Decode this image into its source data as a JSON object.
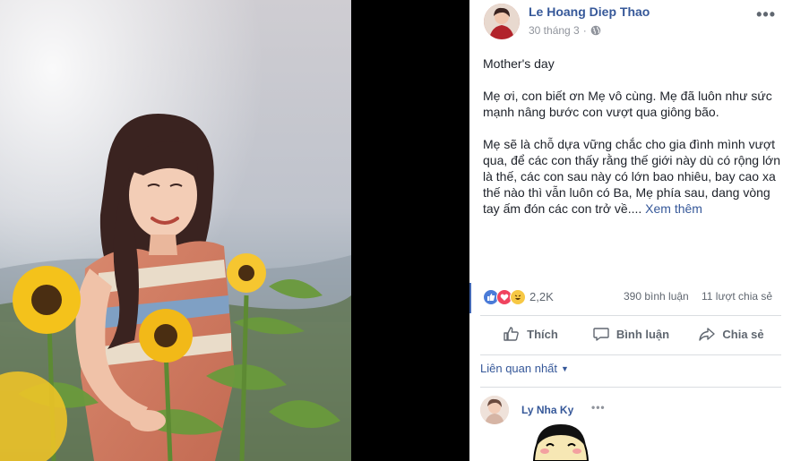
{
  "post": {
    "author": "Le Hoang Diep Thao",
    "date": "30 tháng 3",
    "privacy_separator": "·",
    "privacy_icon": "globe-icon",
    "more_icon": "•••",
    "paragraphs": [
      "Mother's day",
      "Mẹ ơi, con biết ơn Mẹ vô cùng. Mẹ đã luôn như sức mạnh nâng bước con vượt qua giông bão.",
      "Mẹ sẽ là chỗ dựa vững chắc cho gia đình mình vượt qua, để các con thấy rằng thế giới này dù có rộng lớn là thế, các con sau này có lớn bao nhiêu, bay cao xa thế nào thì vẫn luôn có Ba, Mẹ phía sau, dang vòng tay ấm đón các con trở về...."
    ],
    "see_more": "Xem thêm"
  },
  "stats": {
    "reaction_icons": [
      "like-reaction-icon",
      "love-reaction-icon",
      "haha-reaction-icon"
    ],
    "reaction_count": "2,2K",
    "comments": "390 bình luận",
    "shares": "11 lượt chia sẻ"
  },
  "actions": {
    "like": "Thích",
    "comment": "Bình luận",
    "share": "Chia sẻ"
  },
  "comments_section": {
    "sort_label": "Liên quan nhất",
    "sort_caret": "▼",
    "first_comment": {
      "author": "Ly Nha Ky",
      "more": "•••"
    }
  },
  "colors": {
    "link": "#365899",
    "muted": "#606770",
    "accent": "#4267b2"
  }
}
